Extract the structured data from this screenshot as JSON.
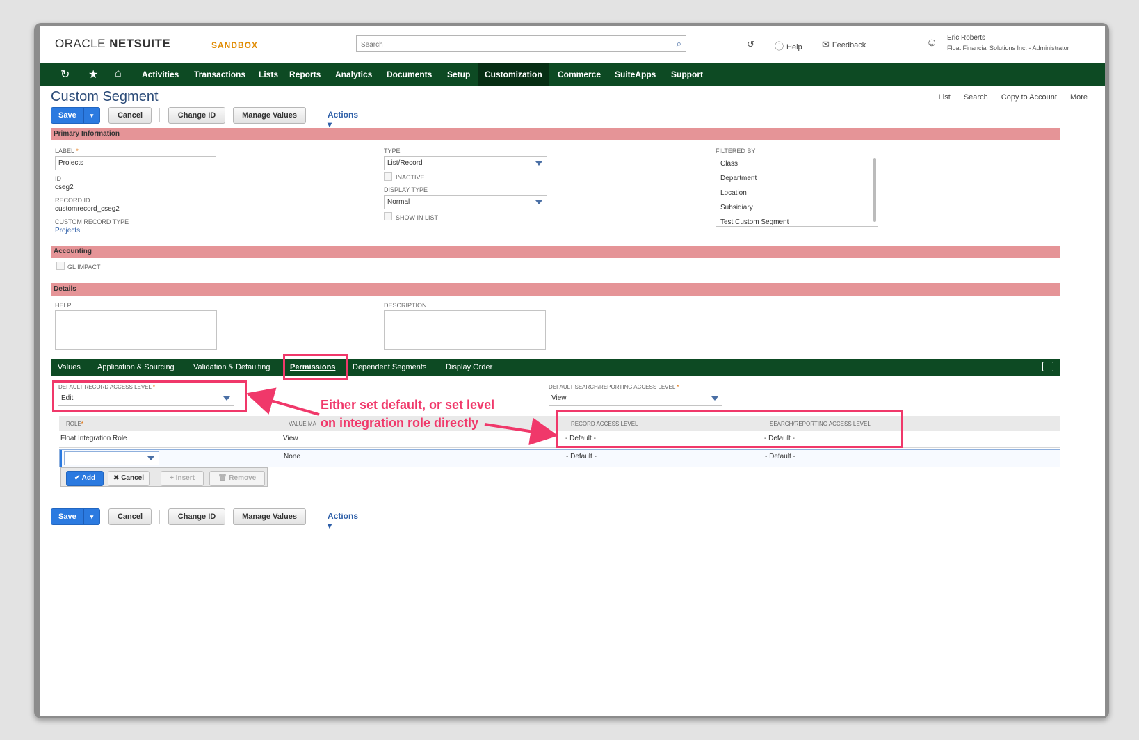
{
  "header": {
    "brand_oracle": "ORACLE",
    "brand_netsuite": "NETSUITE",
    "sandbox": "SANDBOX",
    "search_placeholder": "Search",
    "help": "Help",
    "feedback": "Feedback",
    "user_name": "Eric Roberts",
    "user_role": "Float Financial Solutions Inc. - Administrator"
  },
  "nav": {
    "items": [
      "Activities",
      "Transactions",
      "Lists",
      "Reports",
      "Analytics",
      "Documents",
      "Setup",
      "Customization",
      "Commerce",
      "SuiteApps",
      "Support"
    ],
    "active": "Customization",
    "icons": [
      "recent-icon",
      "star-icon",
      "home-icon"
    ]
  },
  "page": {
    "title": "Custom Segment",
    "top_links": [
      "List",
      "Search",
      "Copy to Account",
      "More"
    ]
  },
  "toolbar": {
    "save": "Save",
    "cancel": "Cancel",
    "change_id": "Change ID",
    "manage_values": "Manage Values",
    "actions": "Actions"
  },
  "primary_info": {
    "section": "Primary Information",
    "label_label": "LABEL",
    "label_value": "Projects",
    "id_label": "ID",
    "id_value": "cseg2",
    "record_id_label": "RECORD ID",
    "record_id_value": "customrecord_cseg2",
    "custom_record_type_label": "CUSTOM RECORD TYPE",
    "custom_record_type_value": "Projects",
    "type_label": "TYPE",
    "type_value": "List/Record",
    "inactive_label": "INACTIVE",
    "display_type_label": "DISPLAY TYPE",
    "display_type_value": "Normal",
    "show_in_list_label": "SHOW IN LIST",
    "filtered_by_label": "FILTERED BY",
    "filtered_by_options": [
      "Class",
      "Department",
      "Location",
      "Subsidiary",
      "Test Custom Segment"
    ]
  },
  "accounting": {
    "section": "Accounting",
    "gl_impact_label": "GL IMPACT"
  },
  "details": {
    "section": "Details",
    "help_label": "HELP",
    "description_label": "DESCRIPTION"
  },
  "subtabs": {
    "items": [
      "Values",
      "Application & Sourcing",
      "Validation & Defaulting",
      "Permissions",
      "Dependent Segments",
      "Display Order"
    ],
    "active": "Permissions"
  },
  "permissions": {
    "default_record_access_label": "DEFAULT RECORD ACCESS LEVEL",
    "default_record_access_value": "Edit",
    "default_search_access_label": "DEFAULT SEARCH/REPORTING ACCESS LEVEL",
    "default_search_access_value": "View",
    "columns": [
      "ROLE",
      "VALUE MA",
      "RECORD ACCESS LEVEL",
      "SEARCH/REPORTING ACCESS LEVEL"
    ],
    "rows": [
      {
        "role": "Float Integration Role",
        "value_mgmt": "View",
        "record_access": "- Default -",
        "search_access": "- Default -"
      },
      {
        "role": "",
        "value_mgmt": "None",
        "record_access": "- Default -",
        "search_access": "- Default -"
      }
    ],
    "buttons": {
      "add": "Add",
      "cancel": "Cancel",
      "insert": "Insert",
      "remove": "Remove"
    }
  },
  "annotation": {
    "text": "Either set default, or set level on integration role directly",
    "color": "#f0386a"
  },
  "colors": {
    "nav_bg": "#0d4a23",
    "section_bg": "#e59497",
    "primary_button": "#2b7ae0",
    "title": "#2b4b78"
  }
}
